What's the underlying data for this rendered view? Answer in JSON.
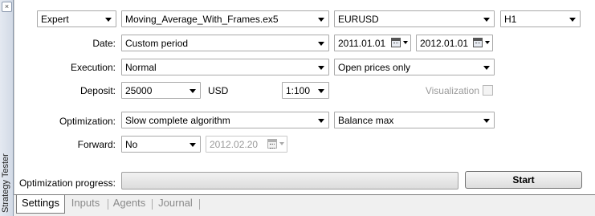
{
  "side_tab": {
    "label": "Strategy Tester",
    "close": "×"
  },
  "row1": {
    "type": "Expert",
    "expert_file": "Moving_Average_With_Frames.ex5",
    "symbol": "EURUSD",
    "period": "H1"
  },
  "date": {
    "label": "Date:",
    "mode": "Custom period",
    "from": "2011.01.01",
    "to": "2012.01.01"
  },
  "execution": {
    "label": "Execution:",
    "delay": "Normal",
    "model": "Open prices only"
  },
  "deposit": {
    "label": "Deposit:",
    "amount": "25000",
    "currency": "USD",
    "leverage": "1:100",
    "visualization_label": "Visualization",
    "visualization_checked": false
  },
  "optimization": {
    "label": "Optimization:",
    "algorithm": "Slow complete algorithm",
    "criterion": "Balance max"
  },
  "forward": {
    "label": "Forward:",
    "mode": "No",
    "date": "2012.02.20"
  },
  "progress": {
    "label": "Optimization progress:",
    "value_percent": 0
  },
  "start_button": "Start",
  "tabs": [
    {
      "label": "Settings",
      "active": true
    },
    {
      "label": "Inputs",
      "active": false
    },
    {
      "label": "Agents",
      "active": false
    },
    {
      "label": "Journal",
      "active": false
    }
  ]
}
